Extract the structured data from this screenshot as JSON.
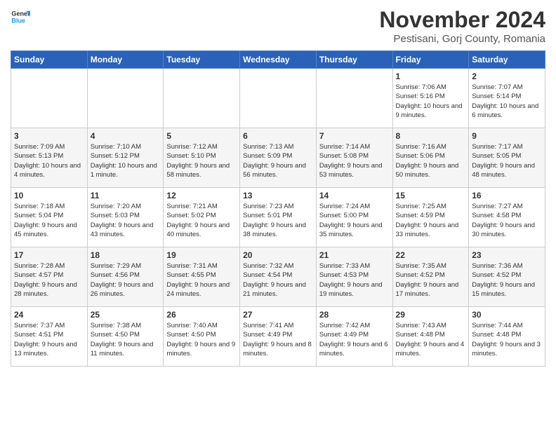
{
  "logo": {
    "line1": "General",
    "line2": "Blue"
  },
  "title": "November 2024",
  "location": "Pestisani, Gorj County, Romania",
  "days_of_week": [
    "Sunday",
    "Monday",
    "Tuesday",
    "Wednesday",
    "Thursday",
    "Friday",
    "Saturday"
  ],
  "weeks": [
    [
      {
        "day": "",
        "info": ""
      },
      {
        "day": "",
        "info": ""
      },
      {
        "day": "",
        "info": ""
      },
      {
        "day": "",
        "info": ""
      },
      {
        "day": "",
        "info": ""
      },
      {
        "day": "1",
        "info": "Sunrise: 7:06 AM\nSunset: 5:16 PM\nDaylight: 10 hours and 9 minutes."
      },
      {
        "day": "2",
        "info": "Sunrise: 7:07 AM\nSunset: 5:14 PM\nDaylight: 10 hours and 6 minutes."
      }
    ],
    [
      {
        "day": "3",
        "info": "Sunrise: 7:09 AM\nSunset: 5:13 PM\nDaylight: 10 hours and 4 minutes."
      },
      {
        "day": "4",
        "info": "Sunrise: 7:10 AM\nSunset: 5:12 PM\nDaylight: 10 hours and 1 minute."
      },
      {
        "day": "5",
        "info": "Sunrise: 7:12 AM\nSunset: 5:10 PM\nDaylight: 9 hours and 58 minutes."
      },
      {
        "day": "6",
        "info": "Sunrise: 7:13 AM\nSunset: 5:09 PM\nDaylight: 9 hours and 56 minutes."
      },
      {
        "day": "7",
        "info": "Sunrise: 7:14 AM\nSunset: 5:08 PM\nDaylight: 9 hours and 53 minutes."
      },
      {
        "day": "8",
        "info": "Sunrise: 7:16 AM\nSunset: 5:06 PM\nDaylight: 9 hours and 50 minutes."
      },
      {
        "day": "9",
        "info": "Sunrise: 7:17 AM\nSunset: 5:05 PM\nDaylight: 9 hours and 48 minutes."
      }
    ],
    [
      {
        "day": "10",
        "info": "Sunrise: 7:18 AM\nSunset: 5:04 PM\nDaylight: 9 hours and 45 minutes."
      },
      {
        "day": "11",
        "info": "Sunrise: 7:20 AM\nSunset: 5:03 PM\nDaylight: 9 hours and 43 minutes."
      },
      {
        "day": "12",
        "info": "Sunrise: 7:21 AM\nSunset: 5:02 PM\nDaylight: 9 hours and 40 minutes."
      },
      {
        "day": "13",
        "info": "Sunrise: 7:23 AM\nSunset: 5:01 PM\nDaylight: 9 hours and 38 minutes."
      },
      {
        "day": "14",
        "info": "Sunrise: 7:24 AM\nSunset: 5:00 PM\nDaylight: 9 hours and 35 minutes."
      },
      {
        "day": "15",
        "info": "Sunrise: 7:25 AM\nSunset: 4:59 PM\nDaylight: 9 hours and 33 minutes."
      },
      {
        "day": "16",
        "info": "Sunrise: 7:27 AM\nSunset: 4:58 PM\nDaylight: 9 hours and 30 minutes."
      }
    ],
    [
      {
        "day": "17",
        "info": "Sunrise: 7:28 AM\nSunset: 4:57 PM\nDaylight: 9 hours and 28 minutes."
      },
      {
        "day": "18",
        "info": "Sunrise: 7:29 AM\nSunset: 4:56 PM\nDaylight: 9 hours and 26 minutes."
      },
      {
        "day": "19",
        "info": "Sunrise: 7:31 AM\nSunset: 4:55 PM\nDaylight: 9 hours and 24 minutes."
      },
      {
        "day": "20",
        "info": "Sunrise: 7:32 AM\nSunset: 4:54 PM\nDaylight: 9 hours and 21 minutes."
      },
      {
        "day": "21",
        "info": "Sunrise: 7:33 AM\nSunset: 4:53 PM\nDaylight: 9 hours and 19 minutes."
      },
      {
        "day": "22",
        "info": "Sunrise: 7:35 AM\nSunset: 4:52 PM\nDaylight: 9 hours and 17 minutes."
      },
      {
        "day": "23",
        "info": "Sunrise: 7:36 AM\nSunset: 4:52 PM\nDaylight: 9 hours and 15 minutes."
      }
    ],
    [
      {
        "day": "24",
        "info": "Sunrise: 7:37 AM\nSunset: 4:51 PM\nDaylight: 9 hours and 13 minutes."
      },
      {
        "day": "25",
        "info": "Sunrise: 7:38 AM\nSunset: 4:50 PM\nDaylight: 9 hours and 11 minutes."
      },
      {
        "day": "26",
        "info": "Sunrise: 7:40 AM\nSunset: 4:50 PM\nDaylight: 9 hours and 9 minutes."
      },
      {
        "day": "27",
        "info": "Sunrise: 7:41 AM\nSunset: 4:49 PM\nDaylight: 9 hours and 8 minutes."
      },
      {
        "day": "28",
        "info": "Sunrise: 7:42 AM\nSunset: 4:49 PM\nDaylight: 9 hours and 6 minutes."
      },
      {
        "day": "29",
        "info": "Sunrise: 7:43 AM\nSunset: 4:48 PM\nDaylight: 9 hours and 4 minutes."
      },
      {
        "day": "30",
        "info": "Sunrise: 7:44 AM\nSunset: 4:48 PM\nDaylight: 9 hours and 3 minutes."
      }
    ]
  ]
}
